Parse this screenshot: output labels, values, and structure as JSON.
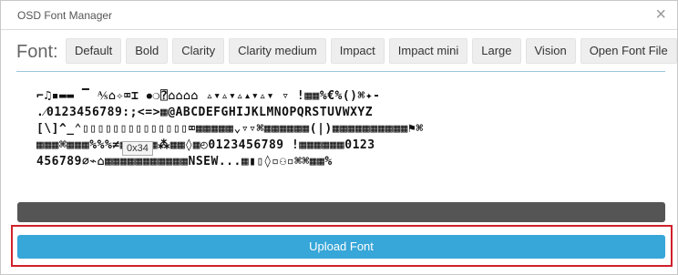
{
  "window": {
    "title": "OSD Font Manager",
    "close_glyph": "×"
  },
  "font_label": "Font:",
  "presets": [
    "Default",
    "Bold",
    "Clarity",
    "Clarity medium",
    "Impact",
    "Impact mini",
    "Large",
    "Vision",
    "Open Font File"
  ],
  "charmap": {
    "rows": [
      "⌐♫▪▬▬  ▔    ⅍⌂✧⌧⌶  ⦁❍⍰⌂⌂⌂⌂ ▵▾▵▾▵▴▾▵▾ ▿  !▦▦%€%()⌘✦-",
      ".⁄0123456789:;<=>▦@ABCDEFGHIJKLMNOPQRSTUVWXYZ",
      "[\\]^_⌃▯▯▯▯▯▯▯▯▯▯▯▯▯▯⌧▦▦▦▦▦⌄▿▿⌘▦▦▦▦▦▦(|)▦▦▦▦▦▦▦▦▦▦⚑⌘",
      "▦▦▦⌘▦▦▦%%%≠▦▦▦▦▦⁂▦▦◊▦◴0123456789 !▦▦▦▦▦▦0123",
      "456789⌀⌁⌂▦▦▦▦▦▦▦▦▦▦▦NSEW...▦▮▯◊▫⚇▫⌘⌘▦▦%"
    ],
    "tooltip": "0x34"
  },
  "upload_label": "Upload Font"
}
